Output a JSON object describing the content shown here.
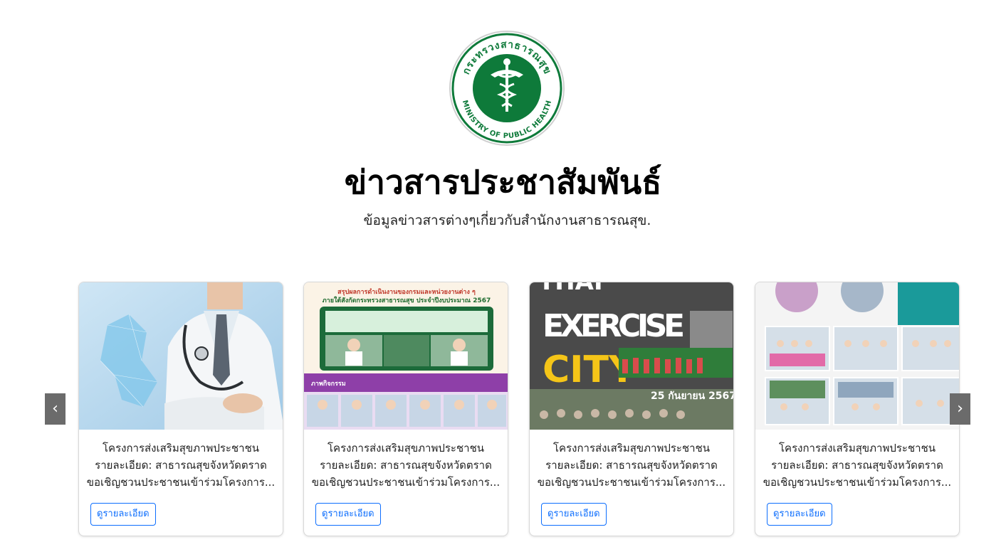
{
  "header": {
    "logo_text_top": "กระทรวงสาธารณสุข",
    "logo_text_bottom": "MINISTRY OF PUBLIC HEALTH",
    "title": "ข่าวสารประชาสัมพันธ์",
    "subtitle": "ข้อมูลข่าวสารต่างๆเกี่ยวกับสำนักงานสาธารณสุข."
  },
  "carousel": {
    "prev_label": "‹",
    "next_label": "›",
    "cards": [
      {
        "line1": "โครงการส่งเสริมสุขภาพประชาชน",
        "line2": "รายละเอียด: สาธารณสุขจังหวัดตราด",
        "line3": "ขอเชิญชวนประชาชนเข้าร่วมโครงการ...",
        "button": "ดูรายละเอียด"
      },
      {
        "line1": "โครงการส่งเสริมสุขภาพประชาชน",
        "line2": "รายละเอียด: สาธารณสุขจังหวัดตราด",
        "line3": "ขอเชิญชวนประชาชนเข้าร่วมโครงการ...",
        "button": "ดูรายละเอียด",
        "image_text": {
          "headline1": "สรุปผลการดำเนินงานของกรมและหน่วยงานต่าง ๆ",
          "headline2": "ภายใต้สังกัดกระทรวงสาธารณสุข ประจำปีงบประมาณ 2567",
          "banner": "ภาพกิจกรรม"
        }
      },
      {
        "line1": "โครงการส่งเสริมสุขภาพประชาชน",
        "line2": "รายละเอียด: สาธารณสุขจังหวัดตราด",
        "line3": "ขอเชิญชวนประชาชนเข้าร่วมโครงการ...",
        "button": "ดูรายละเอียด",
        "image_text": {
          "word1": "THAI",
          "word2": "EXERCISE",
          "word3": "CITY",
          "date": "25 กันยายน 2567"
        }
      },
      {
        "line1": "โครงการส่งเสริมสุขภาพประชาชน",
        "line2": "รายละเอียด: สาธารณสุขจังหวัดตราด",
        "line3": "ขอเชิญชวนประชาชนเข้าร่วมโครงการ...",
        "button": "ดูรายละเอียด"
      }
    ]
  },
  "colors": {
    "brand_green": "#0e7a3a",
    "button_blue": "#0d6efd",
    "nav_gray": "#6b6b6b"
  }
}
